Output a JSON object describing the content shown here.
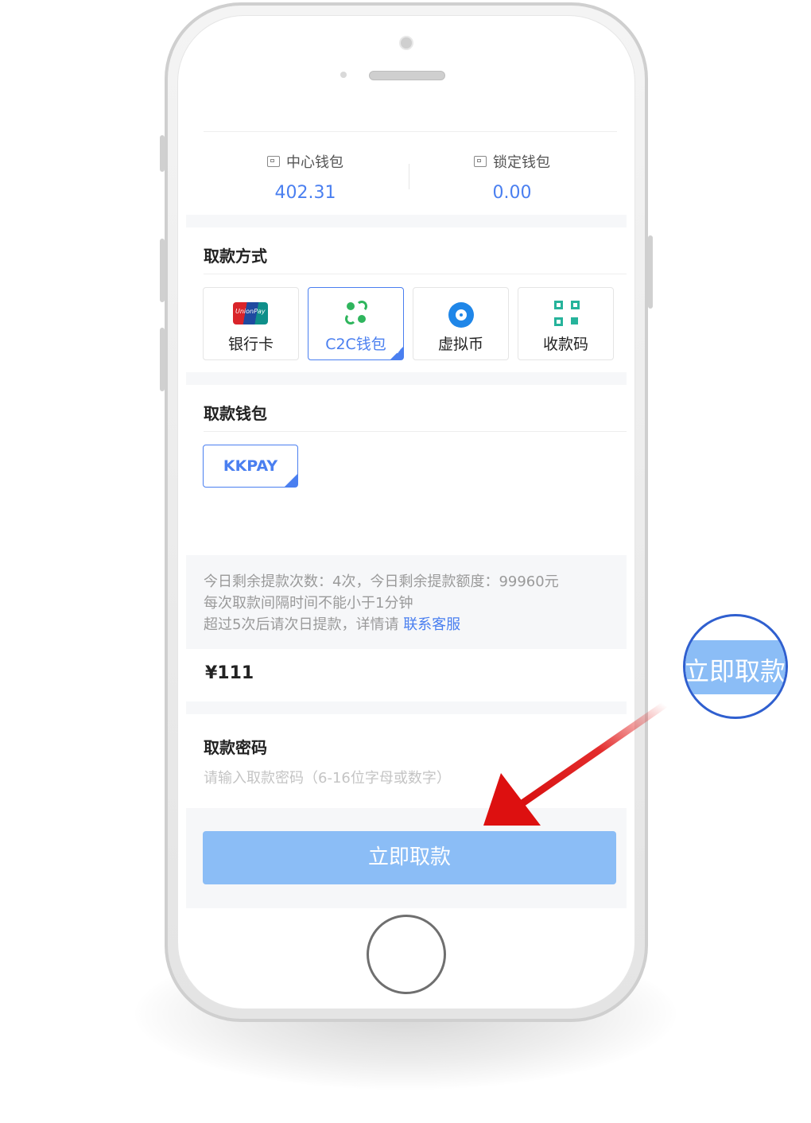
{
  "wallets": {
    "center": {
      "title": "中心钱包",
      "value": "402.31"
    },
    "locked": {
      "title": "锁定钱包",
      "value": "0.00"
    }
  },
  "withdraw_method": {
    "title": "取款方式",
    "options": [
      {
        "label": "银行卡",
        "icon": "unionpay-icon",
        "selected": false
      },
      {
        "label": "C2C钱包",
        "icon": "c2c-icon",
        "selected": true
      },
      {
        "label": "虚拟币",
        "icon": "crypto-coin-icon",
        "selected": false
      },
      {
        "label": "收款码",
        "icon": "qr-code-icon",
        "selected": false
      }
    ],
    "unionpay_text": "UnionPay"
  },
  "withdraw_wallet": {
    "title": "取款钱包",
    "selected_label": "KKPAY"
  },
  "notes": {
    "line1": "今日剩余提款次数：4次，今日剩余提款额度：99960元",
    "line2": "每次取款间隔时间不能小于1分钟",
    "line3_prefix": "超过5次后请次日提款，详情请 ",
    "contact_link": "联系客服"
  },
  "amount": {
    "value": "¥111"
  },
  "password": {
    "title": "取款密码",
    "placeholder": "请输入取款密码（6-16位字母或数字）"
  },
  "submit": {
    "label": "立即取款"
  },
  "zoom_bubble": {
    "label": "立即取款"
  },
  "colors": {
    "accent": "#4a7ff0",
    "button": "#8bbdf6",
    "arrow": "#e01515",
    "bubble_border": "#2f5fcf"
  }
}
